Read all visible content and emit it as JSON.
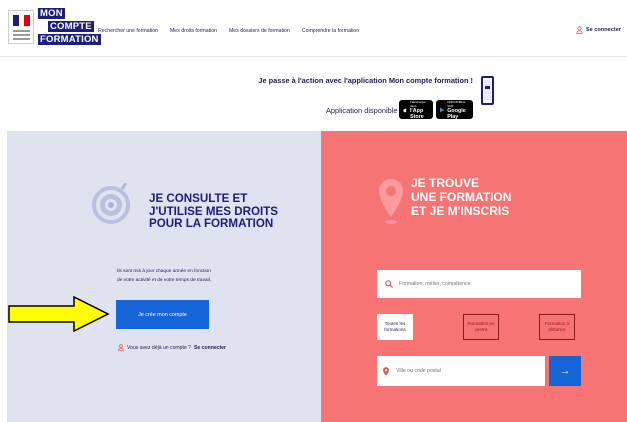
{
  "header": {
    "brand_lines": [
      "MON",
      "COMPTE",
      "FORMATION"
    ],
    "nav": [
      "Rechercher une formation",
      "Mes droits formation",
      "Mes dossiers de formation",
      "Comprendre la formation"
    ],
    "login_label": "Se connecter"
  },
  "app_banner": {
    "title": "Je passe à l'action avec l'application Mon compte formation !",
    "subtitle": "Application disponible sur",
    "appstore_small": "Télécharger dans",
    "appstore_big": "l'App Store",
    "googleplay_small": "DISPONIBLE SUR",
    "googleplay_big": "Google Play"
  },
  "left": {
    "title_lines": [
      "JE CONSULTE ET",
      "J'UTILISE MES DROITS",
      "POUR LA FORMATION"
    ],
    "desc_lines": [
      "Ils sont mis à jour chaque année en fonction",
      "de votre activité et de votre temps de travail."
    ],
    "create_button": "Je crée mon compte",
    "already_text": "Vous avez déjà un compte ?",
    "already_link": "Se connecter"
  },
  "right": {
    "title_lines": [
      "JE TROUVE",
      "UNE FORMATION",
      "ET JE M'INSCRIS"
    ],
    "search_placeholder": "Formation, métier, compétence",
    "modes": [
      {
        "line1": "Toutes les",
        "line2": "formations"
      },
      {
        "line1": "Formation en",
        "line2": "centre"
      },
      {
        "line1": "Formation à",
        "line2": "distance"
      }
    ],
    "city_placeholder": "Ville ou code postal",
    "go_icon": "→"
  },
  "colors": {
    "navy": "#1d1d7a",
    "blue_button": "#1565d8",
    "left_bg": "#dfe2ef",
    "right_bg": "#f77474",
    "arrow_yellow": "#ffff00"
  }
}
